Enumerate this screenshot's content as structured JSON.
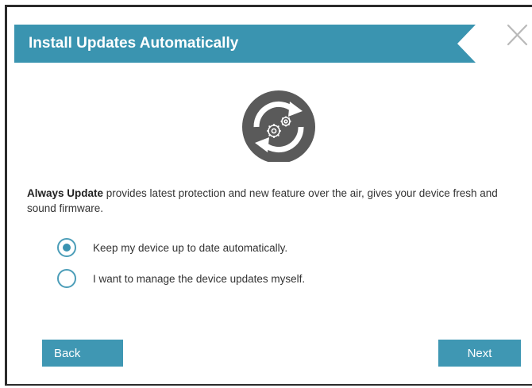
{
  "header": {
    "title": "Install Updates Automatically",
    "banner_color": "#3a94b0"
  },
  "close_icon": "close-icon",
  "hero_icon": "update-gears-icon",
  "description": {
    "bold_lead": "Always Update",
    "rest": " provides latest protection and new feature over the air, gives your device fresh and sound firmware."
  },
  "options": [
    {
      "label": "Keep my device up to date automatically.",
      "checked": true
    },
    {
      "label": "I want to manage the device updates myself.",
      "checked": false
    }
  ],
  "buttons": {
    "back_label": "Back",
    "next_label": "Next",
    "color": "#3f97b3"
  }
}
